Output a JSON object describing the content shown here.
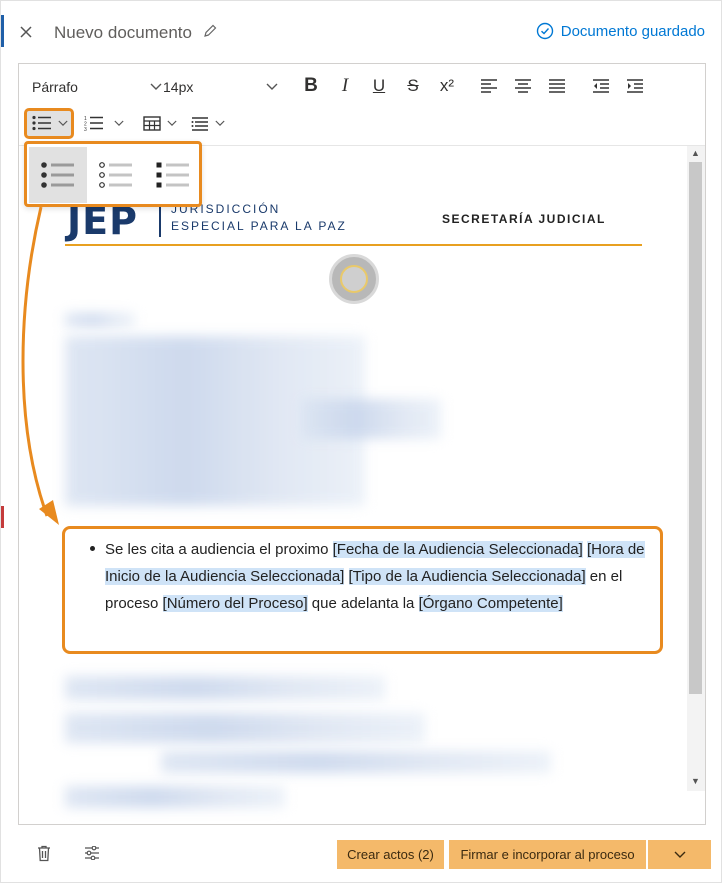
{
  "header": {
    "title": "Nuevo documento",
    "saved_label": "Documento guardado"
  },
  "toolbar": {
    "paragraph_style": "Párrafo",
    "font_size": "14px",
    "bold": "B",
    "italic": "I",
    "underline": "U",
    "strikethrough": "S",
    "superscript": "x²"
  },
  "list_popup": {
    "options": [
      "disc",
      "circle",
      "square"
    ],
    "selected": "disc"
  },
  "document": {
    "logo_text": "JEP",
    "org_line1": "JURISDICCIÓN",
    "org_line2": "ESPECIAL PARA LA PAZ",
    "department": "SECRETARÍA JUDICIAL",
    "bullet": {
      "t1": "Se les cita a audiencia el proximo ",
      "p1": "[Fecha de la Audiencia Seleccionada]",
      "t2": " ",
      "p2": "[Hora de Inicio de la Audiencia Seleccionada]",
      "t3": " ",
      "p3": "[Tipo de la Audiencia Seleccionada]",
      "t4": " en el proceso ",
      "p4": "[Número del Proceso]",
      "t5": " que adelanta la ",
      "p5": "[Órgano Competente]"
    }
  },
  "footer": {
    "create_acts": "Crear actos (2)",
    "sign_incorporate": "Firmar e incorporar al proceso"
  },
  "colors": {
    "accent": "#0078d4",
    "highlight": "#e88a1f",
    "button": "#f4b96a",
    "placeholder_bg": "#cfe3f7"
  }
}
